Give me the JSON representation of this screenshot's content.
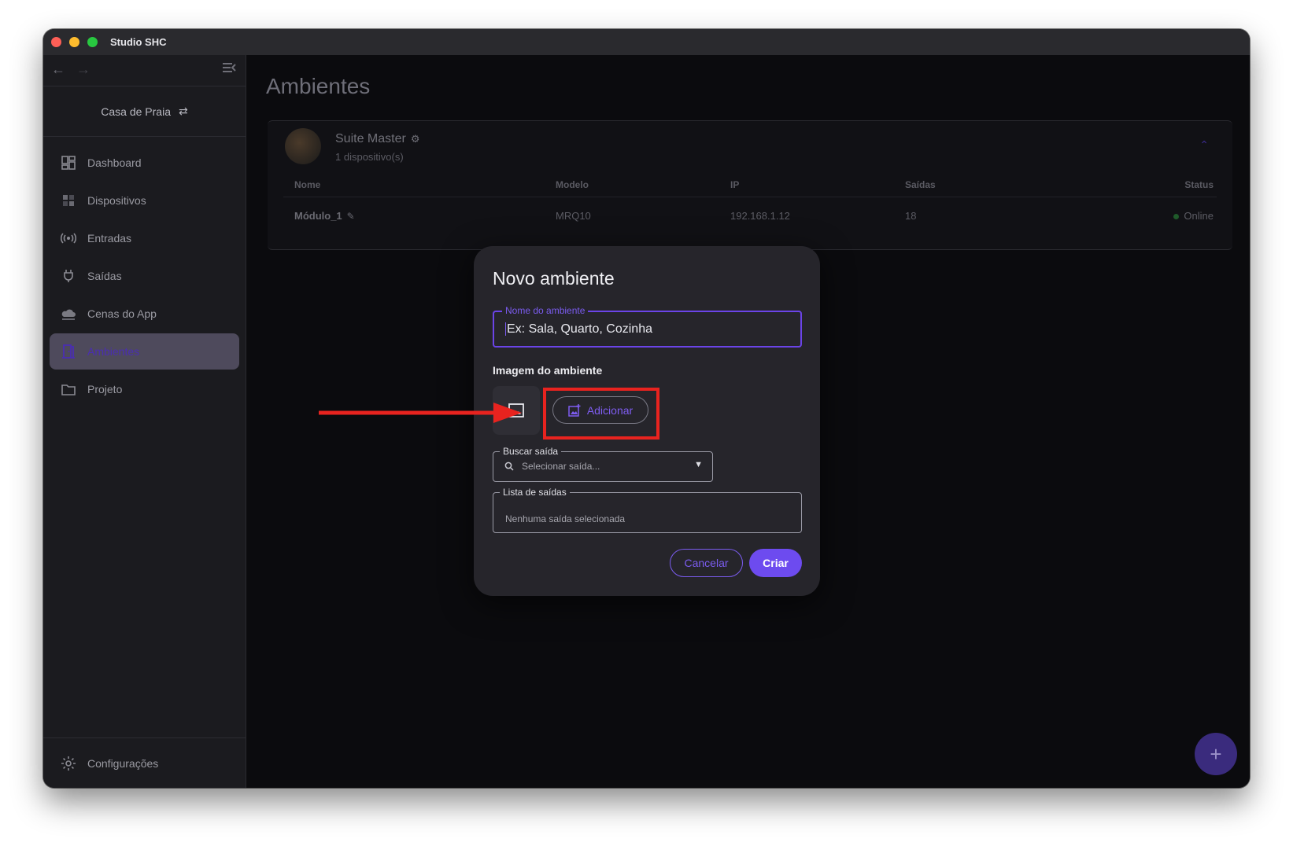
{
  "window": {
    "title": "Studio SHC"
  },
  "sidebar": {
    "project": "Casa de Praia",
    "items": [
      {
        "label": "Dashboard",
        "icon": "dashboard-icon"
      },
      {
        "label": "Dispositivos",
        "icon": "devices-icon"
      },
      {
        "label": "Entradas",
        "icon": "sensors-icon"
      },
      {
        "label": "Saídas",
        "icon": "plug-icon"
      },
      {
        "label": "Cenas do App",
        "icon": "cloud-icon"
      },
      {
        "label": "Ambientes",
        "icon": "door-icon",
        "active": true
      },
      {
        "label": "Projeto",
        "icon": "folder-icon"
      }
    ],
    "settings_label": "Configurações"
  },
  "main": {
    "title": "Ambientes",
    "room": {
      "name": "Suite Master",
      "subtitle": "1 dispositivo(s)",
      "columns": [
        "Nome",
        "Modelo",
        "IP",
        "Saídas",
        "Status"
      ],
      "rows": [
        {
          "name": "Módulo_1",
          "model": "MRQ10",
          "ip": "192.168.1.12",
          "outputs": "18",
          "status": "Online"
        }
      ]
    }
  },
  "dialog": {
    "title": "Novo ambiente",
    "name_field": {
      "label": "Nome do ambiente",
      "placeholder": "Ex: Sala, Quarto, Cozinha"
    },
    "image_label": "Imagem do ambiente",
    "add_button": "Adicionar",
    "search_field": {
      "label": "Buscar saída",
      "placeholder": "Selecionar saída..."
    },
    "list_field": {
      "label": "Lista de saídas",
      "value": "Nenhuma saída selecionada"
    },
    "cancel_button": "Cancelar",
    "create_button": "Criar"
  },
  "colors": {
    "accent": "#6d4bef",
    "annotation": "#e8231f"
  }
}
